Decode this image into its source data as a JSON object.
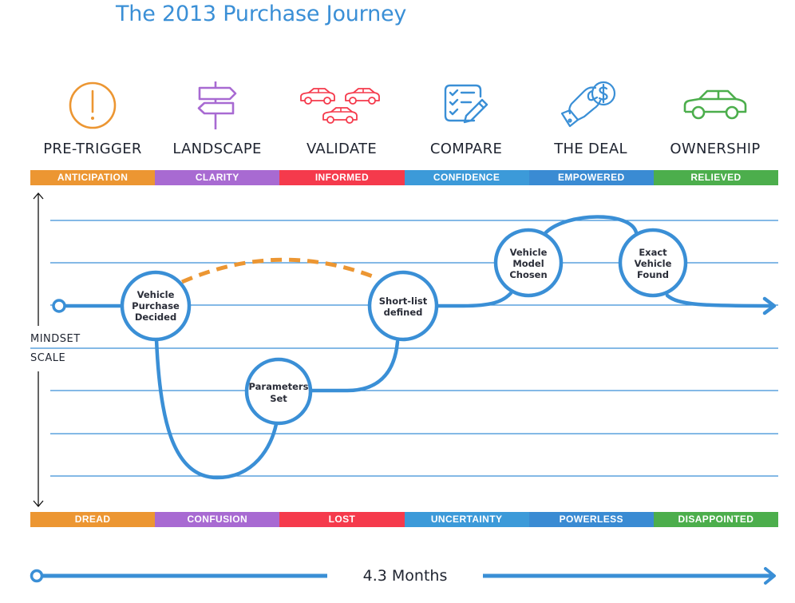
{
  "title": "The 2013 Purchase Journey",
  "colors": {
    "orange": "#ec9632",
    "purple": "#a86ad2",
    "red": "#f53a4c",
    "lightblue": "#3c9ad9",
    "blue": "#3a8bd3",
    "green": "#4cae4c",
    "path": "#3a8fd6",
    "grid": "#3a8fd6",
    "dashed": "#ec9632"
  },
  "stages": [
    {
      "label": "PRE-TRIGGER",
      "icon": "alert-circle-icon",
      "positive": "ANTICIPATION",
      "negative": "DREAD",
      "color": "#ec9632"
    },
    {
      "label": "LANDSCAPE",
      "icon": "signpost-icon",
      "positive": "CLARITY",
      "negative": "CONFUSION",
      "color": "#a86ad2"
    },
    {
      "label": "VALIDATE",
      "icon": "cars-icon",
      "positive": "INFORMED",
      "negative": "LOST",
      "color": "#f53a4c"
    },
    {
      "label": "COMPARE",
      "icon": "checklist-icon",
      "positive": "CONFIDENCE",
      "negative": "UNCERTAINTY",
      "color": "#3c9ad9"
    },
    {
      "label": "THE DEAL",
      "icon": "hand-money-icon",
      "positive": "EMPOWERED",
      "negative": "POWERLESS",
      "color": "#3a8bd3"
    },
    {
      "label": "OWNERSHIP",
      "icon": "car-icon",
      "positive": "RELIEVED",
      "negative": "DISAPPOINTED",
      "color": "#4cae4c"
    }
  ],
  "axis": {
    "line1": "MINDSET",
    "line2": "SCALE"
  },
  "milestones": [
    {
      "id": "vehicle-purchase-decided",
      "lines": [
        "Vehicle",
        "Purchase",
        "Decided"
      ]
    },
    {
      "id": "parameters-set",
      "lines": [
        "Parameters",
        "Set"
      ]
    },
    {
      "id": "short-list-defined",
      "lines": [
        "Short-list",
        "defined"
      ]
    },
    {
      "id": "vehicle-model-chosen",
      "lines": [
        "Vehicle",
        "Model",
        "Chosen"
      ]
    },
    {
      "id": "exact-vehicle-found",
      "lines": [
        "Exact",
        "Vehicle",
        "Found"
      ]
    }
  ],
  "duration": "4.3 Months"
}
